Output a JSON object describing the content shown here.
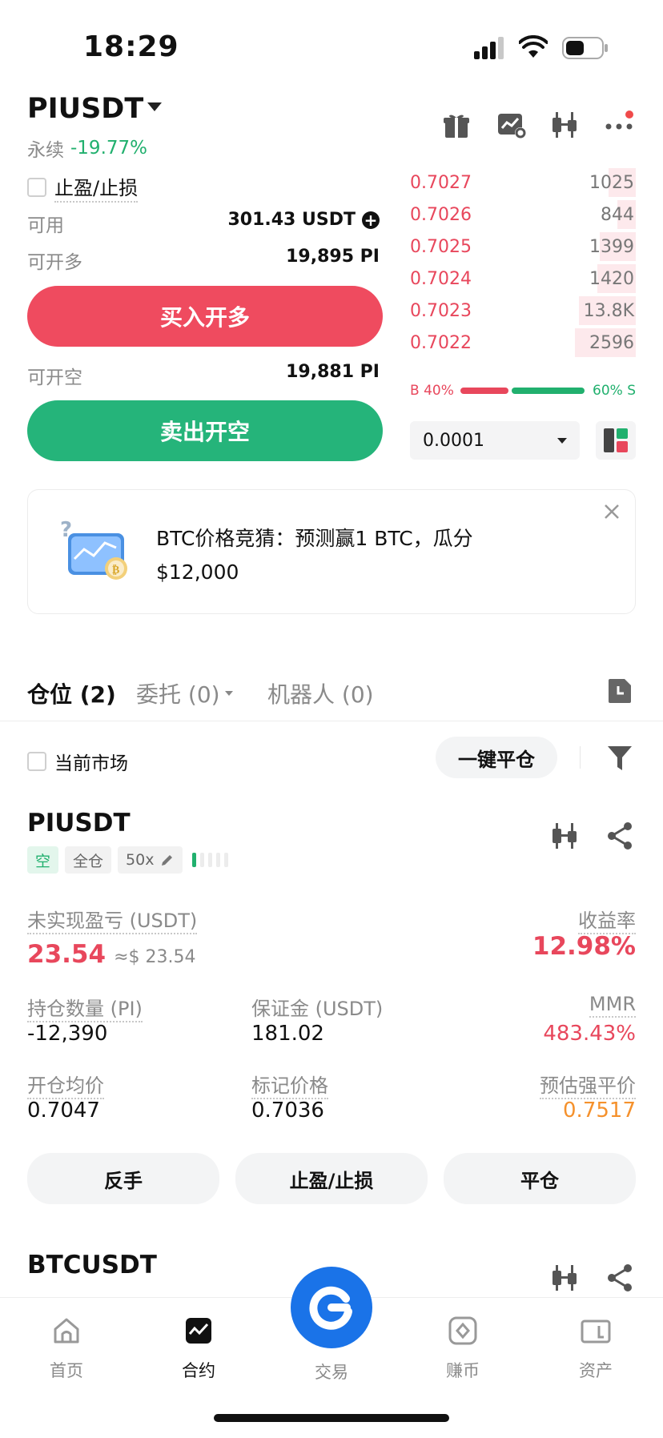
{
  "status": {
    "time": "18:29"
  },
  "header": {
    "pair": "PIUSDT",
    "contract_type": "永续",
    "change": "-19.77%"
  },
  "form": {
    "tpsl_label": "止盈/止损",
    "available_label": "可用",
    "available_value": "301.43 USDT",
    "open_long_label": "可开多",
    "open_long_value": "19,895 PI",
    "buy_btn": "买入开多",
    "open_short_label": "可开空",
    "open_short_value": "19,881 PI",
    "sell_btn": "卖出开空"
  },
  "orderbook": {
    "asks": [
      {
        "price": "0.7027",
        "qty": "1025",
        "depth": 0.12
      },
      {
        "price": "0.7026",
        "qty": "844",
        "depth": 0.08
      },
      {
        "price": "0.7025",
        "qty": "1399",
        "depth": 0.16
      },
      {
        "price": "0.7024",
        "qty": "1420",
        "depth": 0.17
      },
      {
        "price": "0.7023",
        "qty": "13.8K",
        "depth": 0.25
      },
      {
        "price": "0.7022",
        "qty": "2596",
        "depth": 0.27
      }
    ],
    "buy_ratio_label": "B 40%",
    "sell_ratio_label": "60% S",
    "buy_ratio": 0.4,
    "precision": "0.0001"
  },
  "promo": {
    "text_line1": "BTC价格竞猜：预测赢1 BTC，瓜分",
    "text_line2": "$12,000"
  },
  "tabs": {
    "positions": "仓位 (2)",
    "orders": "委托 (0)",
    "bots": "机器人 (0)"
  },
  "filter": {
    "current_market": "当前市场",
    "close_all": "一键平仓"
  },
  "position1": {
    "symbol": "PIUSDT",
    "side": "空",
    "margin_mode": "全仓",
    "leverage": "50x",
    "upnl_label": "未实现盈亏 (USDT)",
    "upnl_value": "23.54",
    "upnl_usd": "≈$ 23.54",
    "roe_label": "收益率",
    "roe_value": "12.98%",
    "qty_label": "持仓数量 (PI)",
    "qty_value": "-12,390",
    "margin_label": "保证金 (USDT)",
    "margin_value": "181.02",
    "mmr_label": "MMR",
    "mmr_value": "483.43%",
    "entry_label": "开仓均价",
    "entry_value": "0.7047",
    "mark_label": "标记价格",
    "mark_value": "0.7036",
    "liq_label": "预估强平价",
    "liq_value": "0.7517",
    "btn_reverse": "反手",
    "btn_tpsl": "止盈/止损",
    "btn_close": "平仓"
  },
  "position2": {
    "symbol": "BTCUSDT"
  },
  "nav": {
    "home": "首页",
    "futures": "合约",
    "trade": "交易",
    "earn": "赚币",
    "assets": "资产"
  },
  "colors": {
    "red": "#e8475c",
    "green": "#21b06e",
    "orange": "#f5912c",
    "brand": "#1a73e8"
  }
}
